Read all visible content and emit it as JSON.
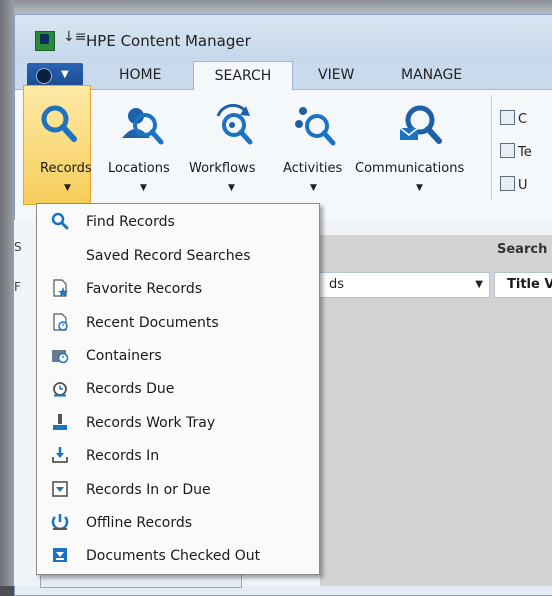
{
  "window": {
    "title": "HPE Content Manager",
    "qat_glyph": "↓≡"
  },
  "tabs": [
    "HOME",
    "SEARCH",
    "VIEW",
    "MANAGE"
  ],
  "ribbon": {
    "buttons": [
      "Records",
      "Locations",
      "Workflows",
      "Activities",
      "Communications"
    ],
    "side_items": [
      "C",
      "Te",
      "U"
    ]
  },
  "content": {
    "search_label": "Search",
    "combo_text": "ds",
    "title_combo": "Title V",
    "left_stub_top": "S",
    "left_stub_mid": "F"
  },
  "menu": {
    "items": [
      {
        "label": "Find Records",
        "icon": "search-icon"
      },
      {
        "label": "Saved Record Searches",
        "icon": ""
      },
      {
        "label": "Favorite Records",
        "icon": "star-document-icon"
      },
      {
        "label": "Recent Documents",
        "icon": "clock-document-icon"
      },
      {
        "label": "Containers",
        "icon": "container-icon"
      },
      {
        "label": "Records Due",
        "icon": "alarm-icon"
      },
      {
        "label": "Records Work Tray",
        "icon": "work-tray-icon"
      },
      {
        "label": "Records In",
        "icon": "inbox-icon"
      },
      {
        "label": "Records In or Due",
        "icon": "inbox-due-icon"
      },
      {
        "label": "Offline Records",
        "icon": "offline-icon"
      },
      {
        "label": "Documents Checked Out",
        "icon": "checked-out-icon"
      }
    ]
  },
  "colors": {
    "accent": "#1b73c2",
    "highlight": "#f7cd5b",
    "menu_bg": "#fafafa"
  }
}
